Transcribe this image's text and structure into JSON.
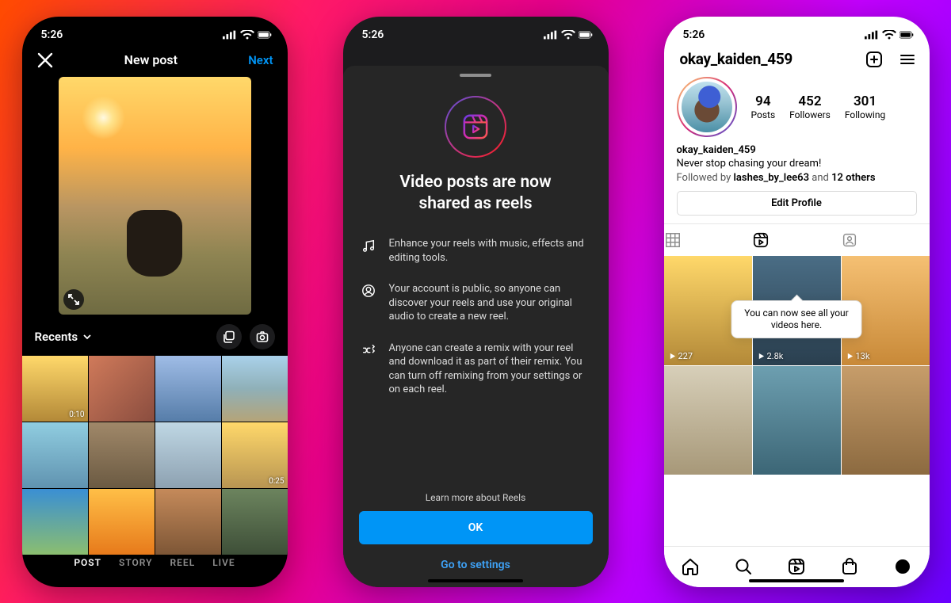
{
  "status": {
    "time": "5:26"
  },
  "screen1": {
    "title": "New post",
    "next": "Next",
    "recents": "Recents",
    "modes": [
      "POST",
      "STORY",
      "REEL",
      "LIVE"
    ],
    "dur1": "0:10",
    "dur2": "0:25"
  },
  "screen2": {
    "title": "Video posts are now shared as reels",
    "item1": "Enhance your reels with music, effects and editing tools.",
    "item2": "Your account is public, so anyone can discover your reels and use your original audio to create a new reel.",
    "item3": "Anyone can create a remix with your reel and download it as part of their remix. You can turn off remixing from your settings or on each reel.",
    "learn": "Learn more about Reels",
    "ok": "OK",
    "settings": "Go to settings"
  },
  "screen3": {
    "username": "okay_kaiden_459",
    "stats": {
      "posts_n": "94",
      "posts_l": "Posts",
      "followers_n": "452",
      "followers_l": "Followers",
      "following_n": "301",
      "following_l": "Following"
    },
    "bio_name": "okay_kaiden_459",
    "bio_text": "Never stop chasing your dream!",
    "followed_pre": "Followed by ",
    "followed_user": "lashes_by_lee63",
    "followed_mid": " and ",
    "followed_others": "12 others",
    "edit": "Edit Profile",
    "tip": "You can now see all your videos here.",
    "views": [
      "227",
      "2.8k",
      "13k"
    ]
  }
}
